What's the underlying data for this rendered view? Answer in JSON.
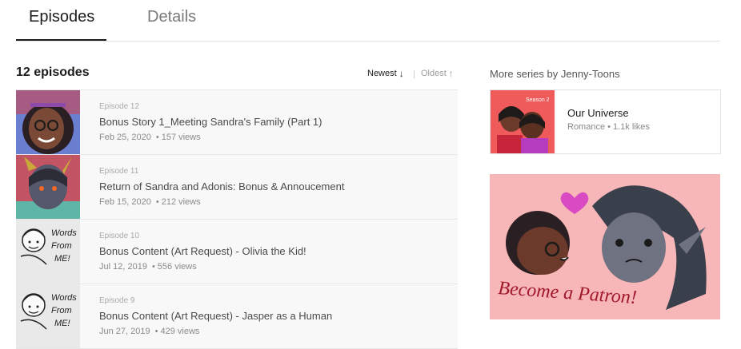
{
  "tabs": [
    {
      "label": "Episodes",
      "active": true
    },
    {
      "label": "Details",
      "active": false
    }
  ],
  "episodes_header": {
    "count_label": "12 episodes",
    "sort_newest": "Newest",
    "sort_oldest": "Oldest"
  },
  "episodes": [
    {
      "number": "Episode 12",
      "title": "Bonus Story 1_Meeting Sandra's Family (Part 1)",
      "date": "Feb 25, 2020",
      "views": "157 views"
    },
    {
      "number": "Episode 11",
      "title": "Return of Sandra and Adonis: Bonus & Annoucement",
      "date": "Feb 15, 2020",
      "views": "212 views"
    },
    {
      "number": "Episode 10",
      "title": "Bonus Content (Art Request) - Olivia the Kid!",
      "date": "Jul 12, 2019",
      "views": "556 views"
    },
    {
      "number": "Episode 9",
      "title": "Bonus Content (Art Request) - Jasper as a Human",
      "date": "Jun 27, 2019",
      "views": "429 views"
    }
  ],
  "sidebar": {
    "more_title": "More series by Jenny-Toons",
    "series": {
      "name": "Our Universe",
      "genre": "Romance",
      "likes": "1.1k likes",
      "thumb_text": "Season 2"
    },
    "patron_banner": {
      "text": "Become a Patron!"
    }
  },
  "colors": {
    "patron_bg": "#f7b6b8",
    "series_thumb_bg": "#ef5a5a",
    "ep11_thumb_bg": "#c25463"
  }
}
